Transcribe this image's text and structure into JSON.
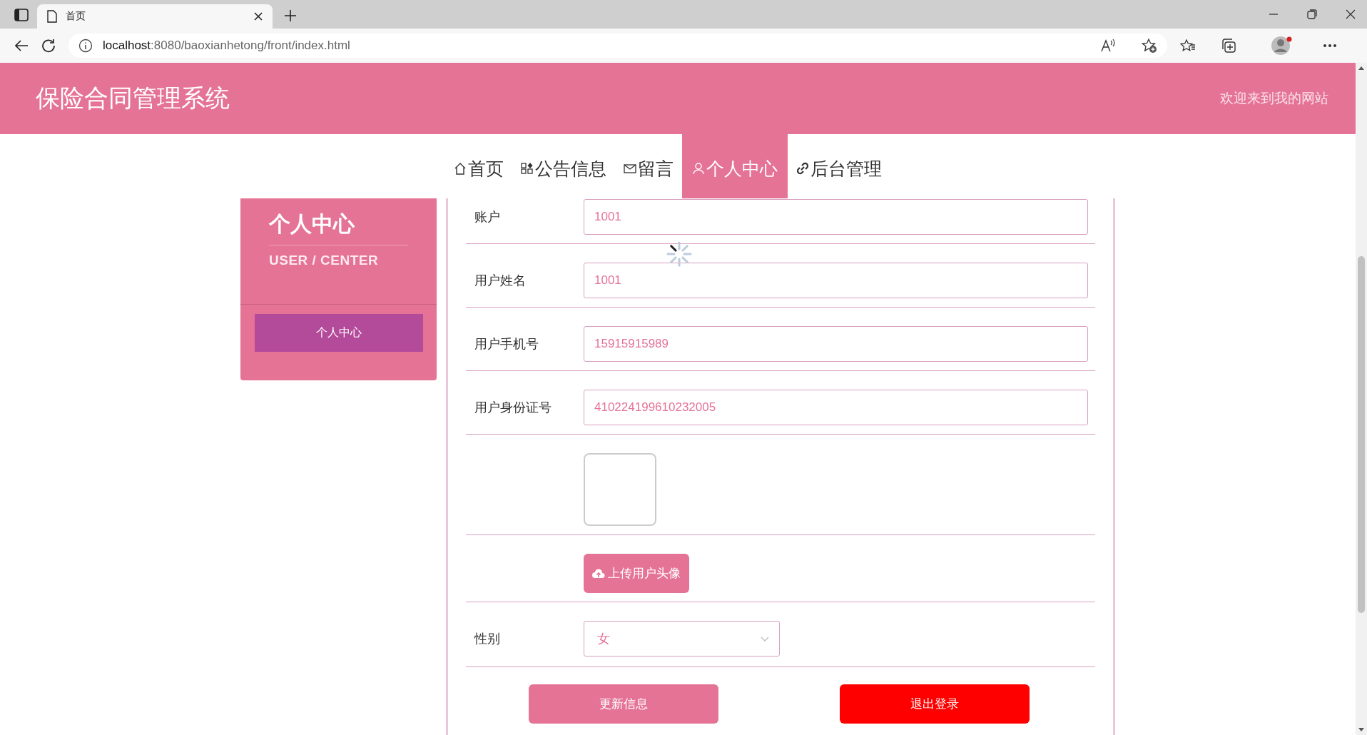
{
  "browser": {
    "tab_title": "首页",
    "url_host": "localhost",
    "url_path": ":8080/baoxianhetong/front/index.html"
  },
  "header": {
    "title": "保险合同管理系统",
    "welcome": "欢迎来到我的网站"
  },
  "nav": [
    {
      "label": "首页",
      "kind": "home",
      "selected": false
    },
    {
      "label": "公告信息",
      "kind": "notices",
      "selected": false
    },
    {
      "label": "留言",
      "kind": "messages",
      "selected": false
    },
    {
      "label": "个人中心",
      "kind": "profile",
      "selected": true
    },
    {
      "label": "后台管理",
      "kind": "admin",
      "selected": false
    }
  ],
  "sidebar": {
    "title": "个人中心",
    "subtitle": "USER / CENTER",
    "items": [
      {
        "label": "个人中心",
        "selected": true
      }
    ]
  },
  "form": {
    "loading": true,
    "fields": [
      {
        "kind": "text",
        "label": "账户",
        "value": "1001"
      },
      {
        "kind": "text",
        "label": "用户姓名",
        "value": "1001"
      },
      {
        "kind": "text",
        "label": "用户手机号",
        "value": "15915915989"
      },
      {
        "kind": "text",
        "label": "用户身份证号",
        "value": "410224199610232005"
      },
      {
        "kind": "image"
      },
      {
        "kind": "upload",
        "button": "上传用户头像"
      },
      {
        "kind": "select",
        "label": "性别",
        "value": "女"
      }
    ],
    "buttons": [
      {
        "label": "更新信息",
        "kind": "primary"
      },
      {
        "label": "退出登录",
        "kind": "danger"
      }
    ]
  }
}
